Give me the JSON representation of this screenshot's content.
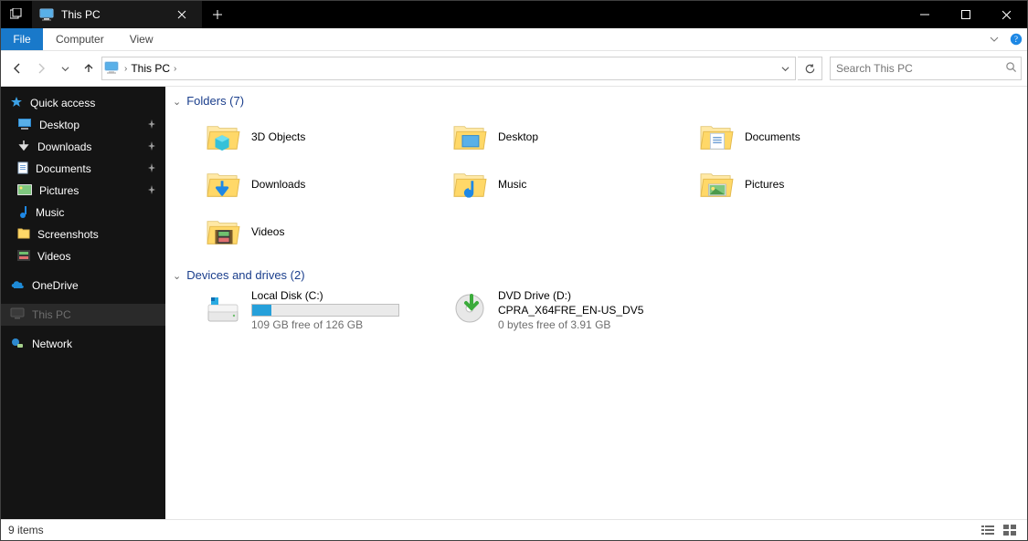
{
  "titlebar": {
    "title": "This PC"
  },
  "ribbon": {
    "file": "File",
    "items": [
      "Computer",
      "View"
    ]
  },
  "nav": {
    "breadcrumb": [
      {
        "label": "This PC"
      }
    ]
  },
  "search": {
    "placeholder": "Search This PC"
  },
  "sidebar": {
    "quick": {
      "label": "Quick access",
      "items": [
        {
          "label": "Desktop",
          "pinned": true,
          "icon": "desktop"
        },
        {
          "label": "Downloads",
          "pinned": true,
          "icon": "downloads"
        },
        {
          "label": "Documents",
          "pinned": true,
          "icon": "documents"
        },
        {
          "label": "Pictures",
          "pinned": true,
          "icon": "pictures"
        },
        {
          "label": "Music",
          "pinned": false,
          "icon": "music"
        },
        {
          "label": "Screenshots",
          "pinned": false,
          "icon": "folder"
        },
        {
          "label": "Videos",
          "pinned": false,
          "icon": "videos"
        }
      ]
    },
    "onedrive": {
      "label": "OneDrive"
    },
    "thispc": {
      "label": "This PC"
    },
    "network": {
      "label": "Network"
    }
  },
  "groups": {
    "folders": {
      "title": "Folders (7)",
      "items": [
        {
          "label": "3D Objects",
          "icon": "3d"
        },
        {
          "label": "Desktop",
          "icon": "desktop"
        },
        {
          "label": "Documents",
          "icon": "documents"
        },
        {
          "label": "Downloads",
          "icon": "downloads"
        },
        {
          "label": "Music",
          "icon": "music"
        },
        {
          "label": "Pictures",
          "icon": "pictures"
        },
        {
          "label": "Videos",
          "icon": "videos"
        }
      ]
    },
    "drives": {
      "title": "Devices and drives (2)",
      "items": [
        {
          "label": "Local Disk (C:)",
          "sub": "109 GB free of 126 GB",
          "fill": 13,
          "icon": "hdd"
        },
        {
          "label": "DVD Drive (D:)",
          "label2": "CPRA_X64FRE_EN-US_DV5",
          "sub": "0 bytes free of 3.91 GB",
          "icon": "dvd"
        }
      ]
    }
  },
  "status": {
    "text": "9 items"
  }
}
